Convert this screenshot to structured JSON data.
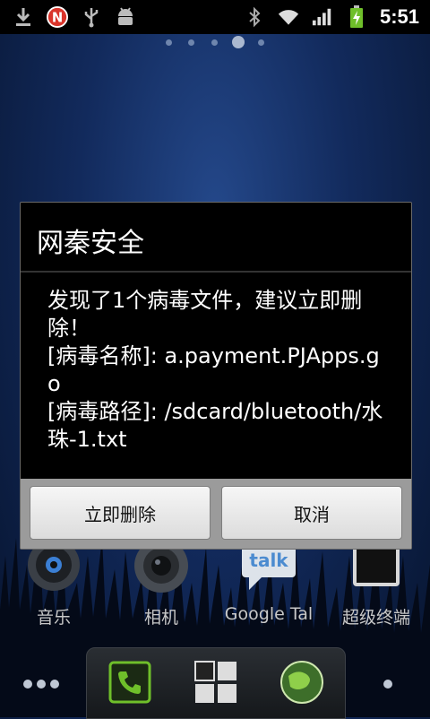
{
  "status_bar": {
    "time": "5:51",
    "left_icons": [
      "download-icon",
      "notification-n-icon",
      "usb-icon",
      "android-debug-icon"
    ],
    "right_icons": [
      "bluetooth-icon",
      "wifi-icon",
      "signal-icon",
      "battery-charging-icon"
    ]
  },
  "home": {
    "apps": [
      {
        "label": "音乐",
        "icon": "music-icon"
      },
      {
        "label": "相机",
        "icon": "camera-icon"
      },
      {
        "label": "Google Tal",
        "icon": "google-talk-icon"
      },
      {
        "label": "超级终端",
        "icon": "terminal-icon"
      }
    ],
    "dock": [
      "phone-icon",
      "app-drawer-icon",
      "browser-icon"
    ]
  },
  "dialog": {
    "title": "网秦安全",
    "message": "发现了1个病毒文件，建议立即删除！\n[病毒名称]: a.payment.PJApps.go\n[病毒路径]: /sdcard/bluetooth/水珠-1.txt",
    "delete_button": "立即删除",
    "cancel_button": "取消"
  }
}
